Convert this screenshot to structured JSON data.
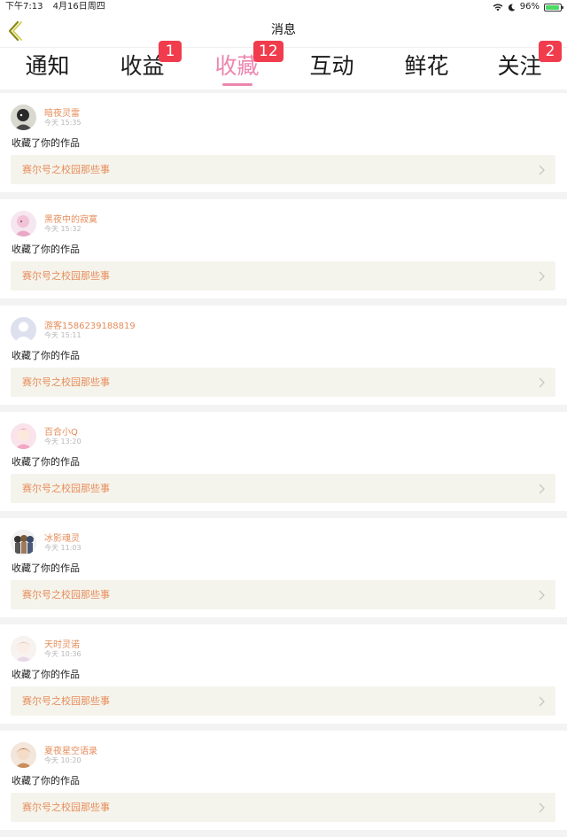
{
  "status_bar": {
    "time": "下午7:13",
    "date": "4月16日周四",
    "battery": "96%"
  },
  "header": {
    "title": "消息"
  },
  "tabs": [
    {
      "label": "通知",
      "badge": ""
    },
    {
      "label": "收益",
      "badge": "1"
    },
    {
      "label": "收藏",
      "badge": "12",
      "active": true
    },
    {
      "label": "互动",
      "badge": ""
    },
    {
      "label": "鲜花",
      "badge": ""
    },
    {
      "label": "关注",
      "badge": "2"
    }
  ],
  "colors": {
    "accent": "#ec86ad",
    "badge": "#f03c4d",
    "username": "#e68c5a",
    "work_bg": "#f5f4ec"
  },
  "items": [
    {
      "user": "暗夜灵雷",
      "time": "今天 15:35",
      "action": "收藏了你的作品",
      "work": "赛尔号之校园那些事",
      "avatar": "dark-character-avatar"
    },
    {
      "user": "黑夜中的寂寞",
      "time": "今天 15:32",
      "action": "收藏了你的作品",
      "work": "赛尔号之校园那些事",
      "avatar": "pink-character-avatar"
    },
    {
      "user": "游客1586239188819",
      "time": "今天 15:11",
      "action": "收藏了你的作品",
      "work": "赛尔号之校园那些事",
      "avatar": "default-guest-avatar"
    },
    {
      "user": "百合小Q",
      "time": "今天 13:20",
      "action": "收藏了你的作品",
      "work": "赛尔号之校园那些事",
      "avatar": "pink-girl-avatar"
    },
    {
      "user": "冰影魂灵",
      "time": "今天 11:03",
      "action": "收藏了你的作品",
      "work": "赛尔号之校园那些事",
      "avatar": "group-characters-avatar"
    },
    {
      "user": "天时灵诺",
      "time": "今天 10:36",
      "action": "收藏了你的作品",
      "work": "赛尔号之校园那些事",
      "avatar": "light-character-avatar"
    },
    {
      "user": "夏夜星空语录",
      "time": "今天 10:20",
      "action": "收藏了你的作品",
      "work": "赛尔号之校园那些事",
      "avatar": "brown-character-avatar"
    }
  ]
}
